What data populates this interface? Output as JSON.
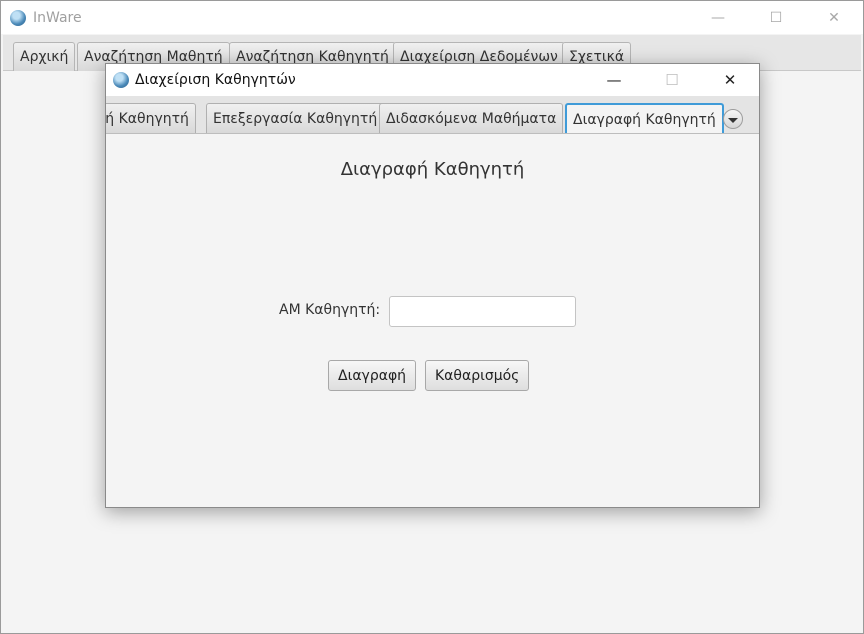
{
  "main_window": {
    "title": "InWare",
    "tabs": [
      "Αρχική",
      "Αναζήτηση Μαθητή",
      "Αναζήτηση Καθηγητή",
      "Διαχείριση Δεδομένων",
      "Σχετικά"
    ],
    "controls": {
      "minimize": "—",
      "maximize": "☐",
      "close": "✕"
    }
  },
  "dialog": {
    "title": "Διαχείριση Καθηγητών",
    "controls": {
      "minimize": "—",
      "maximize": "☐",
      "close": "✕"
    },
    "tabs": [
      "γή Καθηγητή",
      "Επεξεργασία Καθηγητή",
      "Διδασκόμενα Μαθήματα",
      "Διαγραφή Καθηγητή"
    ],
    "active_tab": "Διαγραφή Καθηγητή",
    "form": {
      "title": "Διαγραφή Καθηγητή",
      "am_label": "ΑΜ Καθηγητή:",
      "am_value": "",
      "delete_label": "Διαγραφή",
      "clear_label": "Καθαρισμός"
    }
  },
  "colors": {
    "accent": "#3f9bd8"
  }
}
